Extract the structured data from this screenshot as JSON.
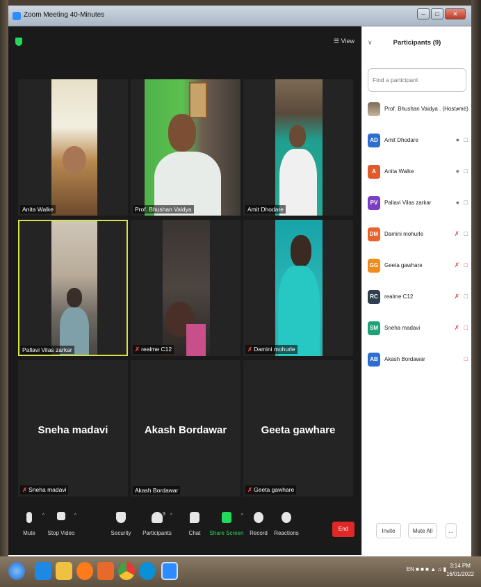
{
  "window": {
    "title": "Zoom Meeting 40-Minutes"
  },
  "meeting": {
    "view_label": "View",
    "tiles": [
      {
        "name": "Anita Walke",
        "muted": false
      },
      {
        "name": "Prof. Bhushan Vaidya",
        "muted": false
      },
      {
        "name": "Amit Dhodare",
        "muted": false
      },
      {
        "name": "Pallavi Vilas zarkar",
        "muted": false,
        "active": true
      },
      {
        "name": "realme C12",
        "muted": true
      },
      {
        "name": "Damini mohurle",
        "muted": true
      },
      {
        "name": "Sneha  madavi",
        "big_name": "Sneha  madavi",
        "muted": true
      },
      {
        "name": "Akash Bordawar",
        "big_name": "Akash Bordawar",
        "muted": false
      },
      {
        "name": "Geeta gawhare",
        "big_name": "Geeta gawhare",
        "muted": true
      }
    ]
  },
  "toolbar": {
    "mute": "Mute",
    "stop_video": "Stop Video",
    "security": "Security",
    "participants": "Participants",
    "participants_count": "9",
    "chat": "Chat",
    "share_screen": "Share Screen",
    "record": "Record",
    "reactions": "Reactions",
    "end": "End"
  },
  "panel": {
    "title": "Participants (9)",
    "search_placeholder": "Find a participant",
    "participants": [
      {
        "initials": "",
        "name": "Prof. Bhushan Vaidya . (Host, me)",
        "color": "#8a7a66",
        "mic_muted": false,
        "cam_off": false
      },
      {
        "initials": "AD",
        "name": "Amit Dhodare",
        "color": "#2d6fd0",
        "mic_muted": false,
        "cam_off": false
      },
      {
        "initials": "A",
        "name": "Anita Walke",
        "color": "#e05a2b",
        "mic_muted": false,
        "cam_off": false
      },
      {
        "initials": "PV",
        "name": "Pallavi Vilas zarkar",
        "color": "#7b3fc4",
        "mic_muted": false,
        "cam_off": false
      },
      {
        "initials": "DM",
        "name": "Damini mohurle",
        "color": "#e8632b",
        "mic_muted": true,
        "cam_off": false
      },
      {
        "initials": "GG",
        "name": "Geeta gawhare",
        "color": "#f08c1c",
        "mic_muted": true,
        "cam_off": true
      },
      {
        "initials": "RC",
        "name": "realme C12",
        "color": "#2f4050",
        "mic_muted": true,
        "cam_off": false
      },
      {
        "initials": "SM",
        "name": "Sneha  madavi",
        "color": "#1fa27a",
        "mic_muted": true,
        "cam_off": true
      },
      {
        "initials": "AB",
        "name": "Akash Bordawar",
        "color": "#2d6fd0",
        "mic_muted": false,
        "cam_off": true
      }
    ],
    "invite": "Invite",
    "mute_all": "Mute All",
    "more": "..."
  },
  "taskbar": {
    "lang": "EN",
    "time": "3:14 PM",
    "date": "16/01/2022"
  },
  "colors": {
    "meeting_bg": "#1a1a1a",
    "active_speaker_outline": "#d8e24a",
    "end_button": "#e02828",
    "share_screen_green": "#23d959"
  }
}
